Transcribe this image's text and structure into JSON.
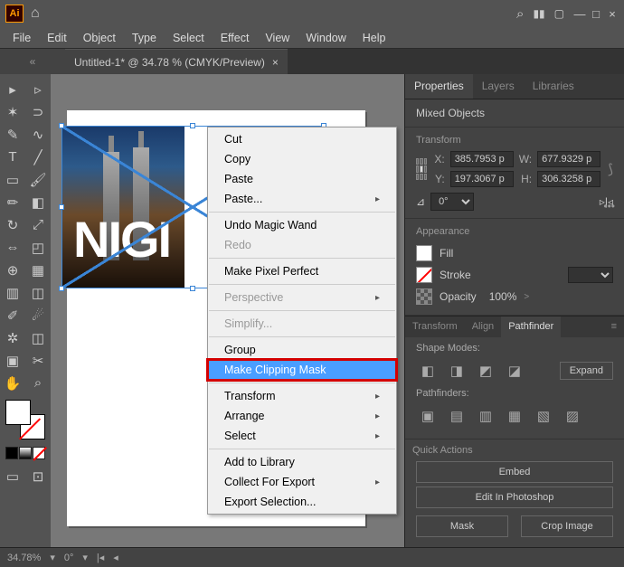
{
  "titlebar": {
    "logo": "Ai"
  },
  "menubar": {
    "items": [
      "File",
      "Edit",
      "Object",
      "Type",
      "Select",
      "Effect",
      "View",
      "Window",
      "Help"
    ]
  },
  "doctab": {
    "title": "Untitled-1* @ 34.78 % (CMYK/Preview)",
    "close": "×"
  },
  "canvas": {
    "text_artwork": "NIGI"
  },
  "context_menu": {
    "items": [
      {
        "label": "Cut",
        "enabled": true
      },
      {
        "label": "Copy",
        "enabled": true
      },
      {
        "label": "Paste",
        "enabled": true
      },
      {
        "label": "Paste...",
        "enabled": true,
        "submenu": true
      },
      {
        "sep": true
      },
      {
        "label": "Undo Magic Wand",
        "enabled": true
      },
      {
        "label": "Redo",
        "enabled": false
      },
      {
        "sep": true
      },
      {
        "label": "Make Pixel Perfect",
        "enabled": true
      },
      {
        "sep": true
      },
      {
        "label": "Perspective",
        "enabled": false,
        "submenu": true
      },
      {
        "sep": true
      },
      {
        "label": "Simplify...",
        "enabled": false
      },
      {
        "sep": true
      },
      {
        "label": "Group",
        "enabled": true
      },
      {
        "label": "Make Clipping Mask",
        "enabled": true,
        "highlight": true
      },
      {
        "sep": true
      },
      {
        "label": "Transform",
        "enabled": true,
        "submenu": true
      },
      {
        "label": "Arrange",
        "enabled": true,
        "submenu": true
      },
      {
        "label": "Select",
        "enabled": true,
        "submenu": true
      },
      {
        "sep": true
      },
      {
        "label": "Add to Library",
        "enabled": true
      },
      {
        "label": "Collect For Export",
        "enabled": true,
        "submenu": true
      },
      {
        "label": "Export Selection...",
        "enabled": true
      }
    ]
  },
  "panels": {
    "tabs": [
      "Properties",
      "Layers",
      "Libraries"
    ],
    "mixed": "Mixed Objects",
    "transform_title": "Transform",
    "X": "385.7953 p",
    "Y": "197.3067 p",
    "W": "677.9329 p",
    "H": "306.3258 p",
    "rotate": "0°",
    "appearance_title": "Appearance",
    "fill_label": "Fill",
    "stroke_label": "Stroke",
    "opacity_label": "Opacity",
    "opacity_value": "100%",
    "small_tabs": [
      "Transform",
      "Align",
      "Pathfinder"
    ],
    "shape_modes": "Shape Modes:",
    "expand": "Expand",
    "pathfinders": "Pathfinders:",
    "quick_actions": "Quick Actions",
    "embed": "Embed",
    "edit_ps": "Edit In Photoshop",
    "mask": "Mask",
    "crop": "Crop Image"
  },
  "statusbar": {
    "zoom": "34.78%",
    "rot": "0°"
  }
}
